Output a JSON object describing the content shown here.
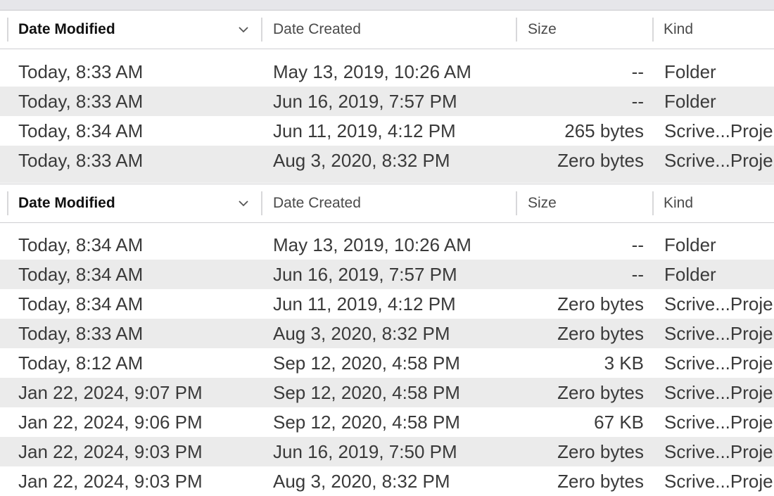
{
  "columns": {
    "date_modified": "Date Modified",
    "date_created": "Date Created",
    "size": "Size",
    "kind": "Kind"
  },
  "sort_indicator": "chevron-down",
  "colors": {
    "row_alt": "#ebebeb",
    "top_strip": "#e6e6ea",
    "header_text_active": "#111111",
    "text": "#3a3a3a"
  },
  "panes": [
    {
      "rows": [
        {
          "modified": "Today, 8:33 AM",
          "created": "May 13, 2019, 10:26 AM",
          "size": "--",
          "kind": "Folder"
        },
        {
          "modified": "Today, 8:33 AM",
          "created": "Jun 16, 2019, 7:57 PM",
          "size": "--",
          "kind": "Folder"
        },
        {
          "modified": "Today, 8:34 AM",
          "created": "Jun 11, 2019, 4:12 PM",
          "size": "265 bytes",
          "kind": "Scrive...Proje"
        },
        {
          "modified": "Today, 8:33 AM",
          "created": "Aug 3, 2020, 8:32 PM",
          "size": "Zero bytes",
          "kind": "Scrive...Proje"
        }
      ]
    },
    {
      "rows": [
        {
          "modified": "Today, 8:34 AM",
          "created": "May 13, 2019, 10:26 AM",
          "size": "--",
          "kind": "Folder"
        },
        {
          "modified": "Today, 8:34 AM",
          "created": "Jun 16, 2019, 7:57 PM",
          "size": "--",
          "kind": "Folder"
        },
        {
          "modified": "Today, 8:34 AM",
          "created": "Jun 11, 2019, 4:12 PM",
          "size": "Zero bytes",
          "kind": "Scrive...Proje"
        },
        {
          "modified": "Today, 8:33 AM",
          "created": "Aug 3, 2020, 8:32 PM",
          "size": "Zero bytes",
          "kind": "Scrive...Proje"
        },
        {
          "modified": "Today, 8:12 AM",
          "created": "Sep 12, 2020, 4:58 PM",
          "size": "3 KB",
          "kind": "Scrive...Proje"
        },
        {
          "modified": "Jan 22, 2024, 9:07 PM",
          "created": "Sep 12, 2020, 4:58 PM",
          "size": "Zero bytes",
          "kind": "Scrive...Proje"
        },
        {
          "modified": "Jan 22, 2024, 9:06 PM",
          "created": "Sep 12, 2020, 4:58 PM",
          "size": "67 KB",
          "kind": "Scrive...Proje"
        },
        {
          "modified": "Jan 22, 2024, 9:03 PM",
          "created": "Jun 16, 2019, 7:50 PM",
          "size": "Zero bytes",
          "kind": "Scrive...Proje"
        },
        {
          "modified": "Jan 22, 2024, 9:03 PM",
          "created": "Aug 3, 2020, 8:32 PM",
          "size": "Zero bytes",
          "kind": "Scrive...Proje"
        }
      ]
    }
  ]
}
